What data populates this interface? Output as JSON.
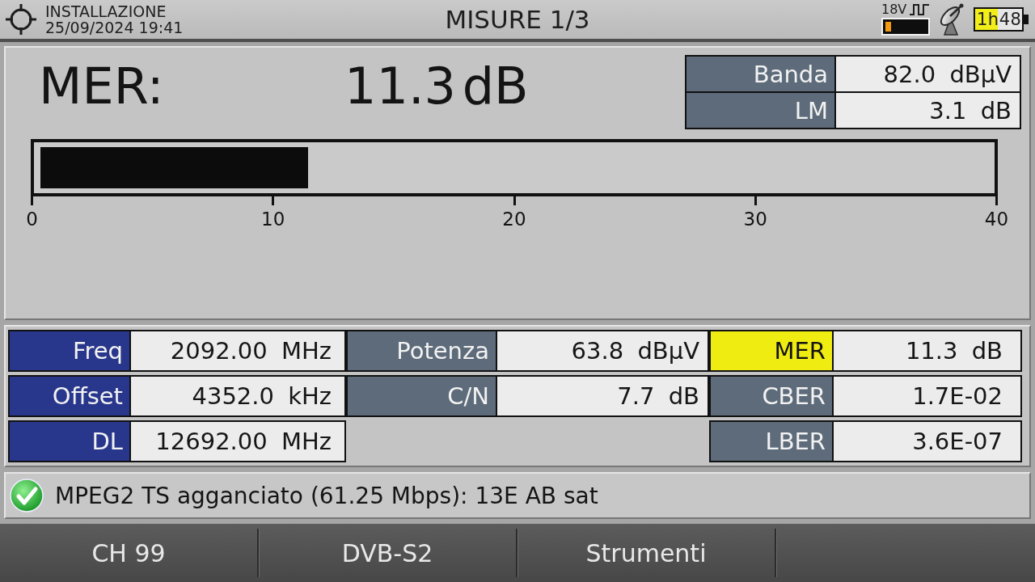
{
  "header": {
    "mode": "INSTALLAZIONE",
    "datetime": "25/09/2024 19:41",
    "title": "MISURE 1/3",
    "lnb_voltage": "18V",
    "battery_time": "1h48"
  },
  "main_measure": {
    "label": "MER:",
    "reading": "11.3 dB",
    "side_table": [
      {
        "label": "Banda",
        "value": "82.0 dBµV"
      },
      {
        "label": "LM",
        "value": "3.1 dB"
      }
    ],
    "meter": {
      "level": 0.2825,
      "scale": [
        "0",
        "10",
        "20",
        "30",
        "40"
      ]
    }
  },
  "grid": {
    "columns": [
      {
        "items": [
          {
            "label": "Freq",
            "value": "2092.00 MHz",
            "kind": "tuning",
            "selected": false
          },
          {
            "label": "Offset",
            "value": "4352.0 kHz",
            "kind": "tuning",
            "selected": false
          },
          {
            "label": "DL",
            "value": "12692.00 MHz",
            "kind": "tuning",
            "selected": false
          }
        ]
      },
      {
        "items": [
          {
            "label": "Potenza",
            "value": "63.8 dBµV",
            "kind": "measure",
            "selected": false
          },
          {
            "label": "C/N",
            "value": "7.7 dB",
            "kind": "measure",
            "selected": false
          }
        ]
      },
      {
        "items": [
          {
            "label": "MER",
            "value": "11.3 dB",
            "kind": "measure",
            "selected": true
          },
          {
            "label": "CBER",
            "value": "1.7E-02",
            "kind": "measure",
            "selected": false
          },
          {
            "label": "LBER",
            "value": "3.6E-07",
            "kind": "measure",
            "selected": false
          }
        ]
      }
    ]
  },
  "status": {
    "locked": true,
    "text": "MPEG2 TS agganciato (61.25 Mbps): 13E AB sat"
  },
  "softkeys": [
    {
      "label": "CH 99"
    },
    {
      "label": "DVB-S2"
    },
    {
      "label": "Strumenti"
    }
  ]
}
